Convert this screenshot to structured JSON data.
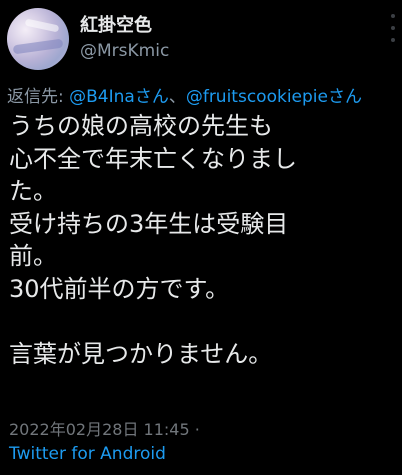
{
  "author": {
    "display_name": "紅掛空色",
    "handle": "@MrsKmic"
  },
  "reply": {
    "prefix": "返信先: ",
    "mention_1": "@B4Inaさん",
    "separator": "、",
    "mention_2": "@fruitscookiepieさん"
  },
  "tweet": {
    "lines": [
      "うちの娘の高校の先生も",
      "心不全で年末亡くなりまし",
      "た。",
      "受け持ちの3年生は受験目",
      "前。",
      "30代前半の方です。",
      "",
      "言葉が見つかりません。"
    ]
  },
  "meta": {
    "timestamp": "2022年02月28日 11:45 · ",
    "client": "Twitter for Android"
  },
  "colors": {
    "background": "#000000",
    "text": "#e7e9ea",
    "muted": "#8b98a5",
    "link": "#1d9bf0"
  }
}
